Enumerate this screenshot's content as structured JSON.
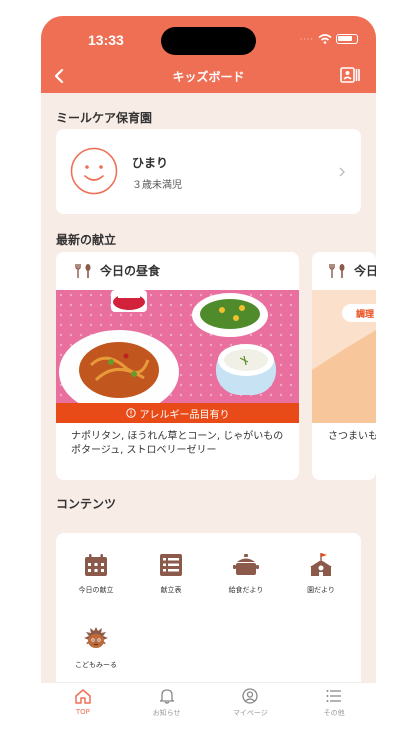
{
  "status": {
    "time": "13:33"
  },
  "header": {
    "title": "キッズボード"
  },
  "facility": {
    "name": "ミールケア保育園"
  },
  "child": {
    "name": "ひまり",
    "age": "３歳未満児"
  },
  "menu_section": {
    "title": "最新の献立"
  },
  "menu_cards": [
    {
      "heading": "今日の昼食",
      "allergy": "アレルギー品目有り",
      "dishes": "ナポリタン, ほうれん草とコーン, じゃがいものポタージュ, ストロベリーゼリー"
    },
    {
      "heading": "今日",
      "badge": "調理",
      "dishes": "さつまいも"
    }
  ],
  "contents_section": {
    "title": "コンテンツ"
  },
  "contents": [
    {
      "label": "今日の献立",
      "icon": "calendar-icon"
    },
    {
      "label": "献立表",
      "icon": "list-icon"
    },
    {
      "label": "給食だより",
      "icon": "pot-icon"
    },
    {
      "label": "園だより",
      "icon": "school-icon"
    },
    {
      "label": "こどもみーる",
      "icon": "chestnut-mascot-icon"
    }
  ],
  "tabs": [
    {
      "label": "TOP",
      "icon": "home-icon",
      "active": true
    },
    {
      "label": "お知らせ",
      "icon": "bell-icon"
    },
    {
      "label": "マイページ",
      "icon": "user-icon"
    },
    {
      "label": "その他",
      "icon": "menu-icon"
    }
  ],
  "colors": {
    "brand": "#ef6f55",
    "allergy": "#e84a18",
    "icon_brown": "#8b5a4a"
  }
}
